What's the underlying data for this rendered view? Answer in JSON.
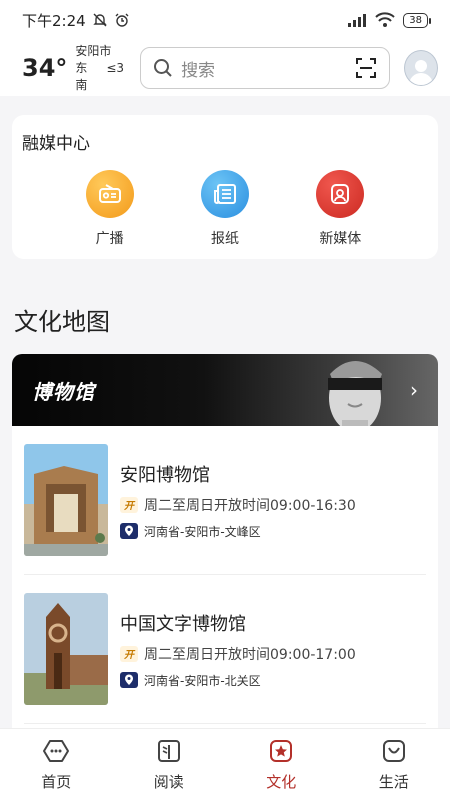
{
  "status": {
    "time": "下午2:24",
    "battery": "38"
  },
  "weather": {
    "temperature": "34°",
    "city": "安阳市",
    "wind_dir": "东南",
    "wind_level": "≤3"
  },
  "search": {
    "placeholder": "搜索"
  },
  "media_center": {
    "title": "融媒中心",
    "items": [
      {
        "label": "广播",
        "icon": "radio-icon",
        "color": "#f5a623"
      },
      {
        "label": "报纸",
        "icon": "newspaper-icon",
        "color": "#3aa0e8"
      },
      {
        "label": "新媒体",
        "icon": "new-media-icon",
        "color": "#d9342b"
      }
    ]
  },
  "culture_map": {
    "title": "文化地图",
    "banner_title": "博物馆",
    "museums": [
      {
        "name": "安阳博物馆",
        "open_badge": "开",
        "hours": "周二至周日开放时间09:00-16:30",
        "address": "河南省-安阳市-文峰区"
      },
      {
        "name": "中国文字博物馆",
        "open_badge": "开",
        "hours": "周二至周日开放时间09:00-17:00",
        "address": "河南省-安阳市-北关区"
      }
    ]
  },
  "bottom_nav": {
    "items": [
      {
        "label": "首页",
        "icon": "home-icon"
      },
      {
        "label": "阅读",
        "icon": "book-icon"
      },
      {
        "label": "文化",
        "icon": "culture-icon",
        "active": true
      },
      {
        "label": "生活",
        "icon": "life-icon"
      }
    ]
  },
  "colors": {
    "accent": "#b3302a",
    "banner_bg": "#000000",
    "card_bg": "#ffffff"
  }
}
